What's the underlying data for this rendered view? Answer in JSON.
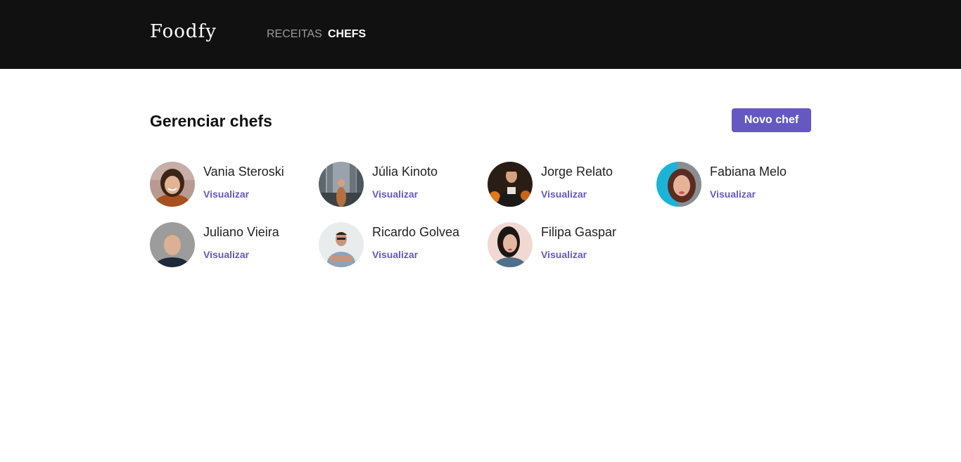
{
  "brand": {
    "logo": "Foodfy"
  },
  "nav": {
    "recipes_label": "RECEITAS",
    "chefs_label": "CHEFS",
    "active": "chefs"
  },
  "page": {
    "title": "Gerenciar chefs",
    "new_button_label": "Novo chef"
  },
  "colors": {
    "header_bg": "#111111",
    "accent": "#6558c3"
  },
  "chefs": [
    {
      "name": "Vania Steroski",
      "link_label": "Visualizar",
      "avatar": "woman-smiling-photo"
    },
    {
      "name": "Júlia Kinoto",
      "link_label": "Visualizar",
      "avatar": "woman-city-street-photo"
    },
    {
      "name": "Jorge Relato",
      "link_label": "Visualizar",
      "avatar": "man-cooking-kitchen-photo"
    },
    {
      "name": "Fabiana Melo",
      "link_label": "Visualizar",
      "avatar": "woman-portrait-blue-background-photo"
    },
    {
      "name": "Juliano Vieira",
      "link_label": "Visualizar",
      "avatar": "man-portrait-gray-background-photo"
    },
    {
      "name": "Ricardo Golvea",
      "link_label": "Visualizar",
      "avatar": "man-arms-crossed-photo"
    },
    {
      "name": "Filipa Gaspar",
      "link_label": "Visualizar",
      "avatar": "woman-dark-hair-photo"
    }
  ]
}
